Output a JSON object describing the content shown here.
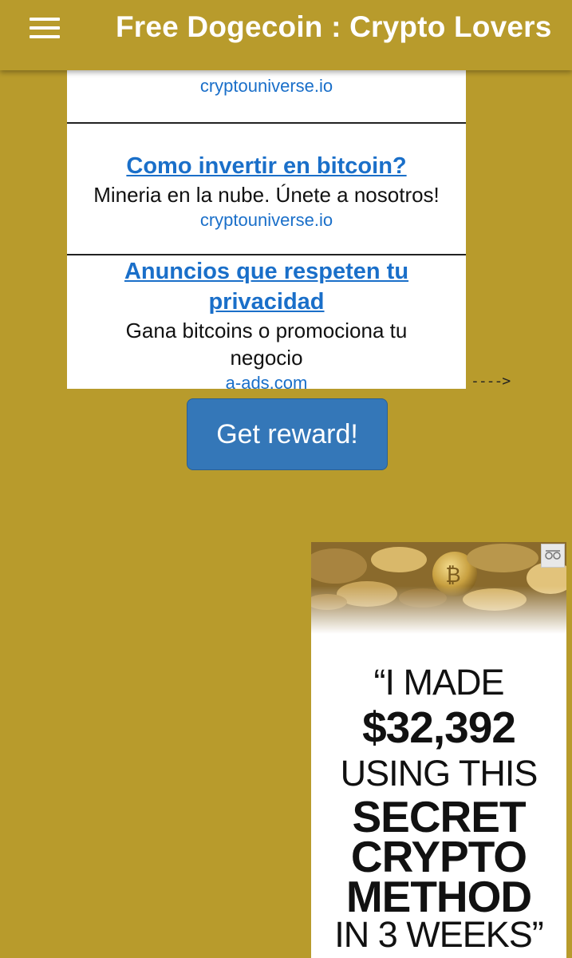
{
  "appbar": {
    "title": "Free Dogecoin : Crypto Lovers",
    "menu_icon": "hamburger-menu-icon"
  },
  "ads": [
    {
      "headline": "",
      "description": "",
      "domain": "cryptouniverse.io"
    },
    {
      "headline": "Como invertir en bitcoin?",
      "description": "Mineria en la nube. Únete a nosotros!",
      "domain": "cryptouniverse.io"
    },
    {
      "headline_line1": "Anuncios que respeten tu",
      "headline_line2": "privacidad",
      "description_line1": "Gana bitcoins o promociona tu",
      "description_line2": "negocio",
      "domain": "a-ads.com"
    }
  ],
  "arrow_text": "---->",
  "reward_button": {
    "label": "Get reward!"
  },
  "banner": {
    "line1": "“I MADE",
    "line2": "$32,392",
    "line3": "USING THIS",
    "line4": "SECRET",
    "line5": "CRYPTO",
    "line6": "METHOD",
    "line7": "IN 3 WEEKS”",
    "adchoices_icon": "adchoices-icon"
  },
  "colors": {
    "background": "#b89b2c",
    "link": "#1a6fc9",
    "button": "#3477b8"
  }
}
